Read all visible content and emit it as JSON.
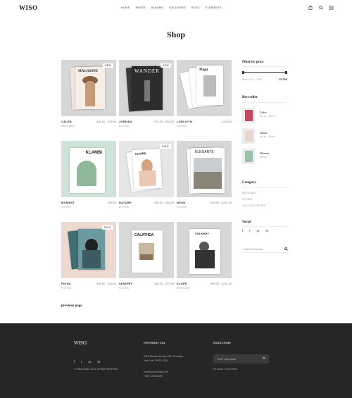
{
  "header": {
    "logo": "WISO",
    "nav": [
      "HOME",
      "PAGES",
      "ALBUMS",
      "GALLERIES",
      "BLOG",
      "ELEMENTS"
    ],
    "icons": [
      "cart-icon",
      "search-icon",
      "menu-icon"
    ]
  },
  "page_title": "Shop",
  "products": [
    {
      "name": "CALEB",
      "price": "£81.00 – £93.00",
      "category": "BERGAMO",
      "badge": "NEW",
      "bg": "#d7d7d7",
      "cover_title": "MAGAZINE"
    },
    {
      "name": "JORDAN",
      "price": "£21.00 – £50.00",
      "category": "FLORIA",
      "badge": "NEW",
      "bg": "#d7d7d7",
      "cover_title": "WANDER"
    },
    {
      "name": "LORLIVYN",
      "price": "£178.00",
      "category": "FLORIA",
      "badge": "",
      "bg": "#d7d7d7",
      "cover_title": "Maga"
    },
    {
      "name": "MOMENT",
      "price": "£99.00",
      "category": "FLORIA",
      "badge": "",
      "bg": "#cfe3d8",
      "cover_title": "KLAMBI"
    },
    {
      "name": "NATURE",
      "price": "£50.00 – £66.00",
      "category": "FLORIA",
      "badge": "SALE",
      "bg": "#e6e6e6",
      "cover_title": "KLAMBI"
    },
    {
      "name": "NEON",
      "price": "£99.00 – £251.00",
      "category": "FLORIA",
      "badge": "",
      "bg": "#d7d7d7",
      "cover_title": "ELEGANTE"
    },
    {
      "name": "PIONA",
      "price": "£50.00 – £49.00",
      "category": "FLORIA",
      "badge": "SALE",
      "bg": "#ecd9cf",
      "cover_title": ""
    },
    {
      "name": "SENIERY",
      "price": "£55.00 – £75.00",
      "category": "FLORIA",
      "badge": "",
      "bg": "#d7d7d7",
      "cover_title": "CALATHEA"
    },
    {
      "name": "SLOPE",
      "price": "£99.00 – £231.00",
      "category": "BERGAMO",
      "badge": "",
      "bg": "#d7d7d7",
      "cover_title": "VOLKNOY"
    }
  ],
  "pagination": {
    "prev": "previous page"
  },
  "sidebar": {
    "filter_title": "Filter by price",
    "price_range": "Price: £21 — £250",
    "filter_button": "FILTER",
    "bestseller_title": "Best seller",
    "bestsellers": [
      {
        "name": "Zoltre",
        "price": "£xx.xx – £xx.xx"
      },
      {
        "name": "Nature",
        "price": "£xx.xx – £xx.xx"
      },
      {
        "name": "Moment",
        "price": "£99.00"
      }
    ],
    "category_title": "Category",
    "categories": [
      "BERGAMO",
      "FLORIA",
      "UNCATEGORIZED"
    ],
    "social_title": "Social",
    "social_icons": [
      "facebook-icon",
      "twitter-icon",
      "instagram-icon",
      "linkedin-icon"
    ],
    "search_placeholder": "Search Products..."
  },
  "footer": {
    "logo": "WISO",
    "copyright": "© Wiso Studio 2018. All Right Reserved.",
    "info_title": "INFORMATION",
    "address": [
      "2005 Stokes Isle Apt. 896, Venaville,",
      "New York 10010, USA"
    ],
    "email": "info@yourdomain.com",
    "phone": "(+68) 120034509",
    "subscribe_title": "SUBSCRIBE",
    "email_placeholder": "Enter your email",
    "no_spam": "No spam, we promise"
  },
  "colors": {
    "footer_bg": "#262626",
    "accent": "#222222"
  }
}
